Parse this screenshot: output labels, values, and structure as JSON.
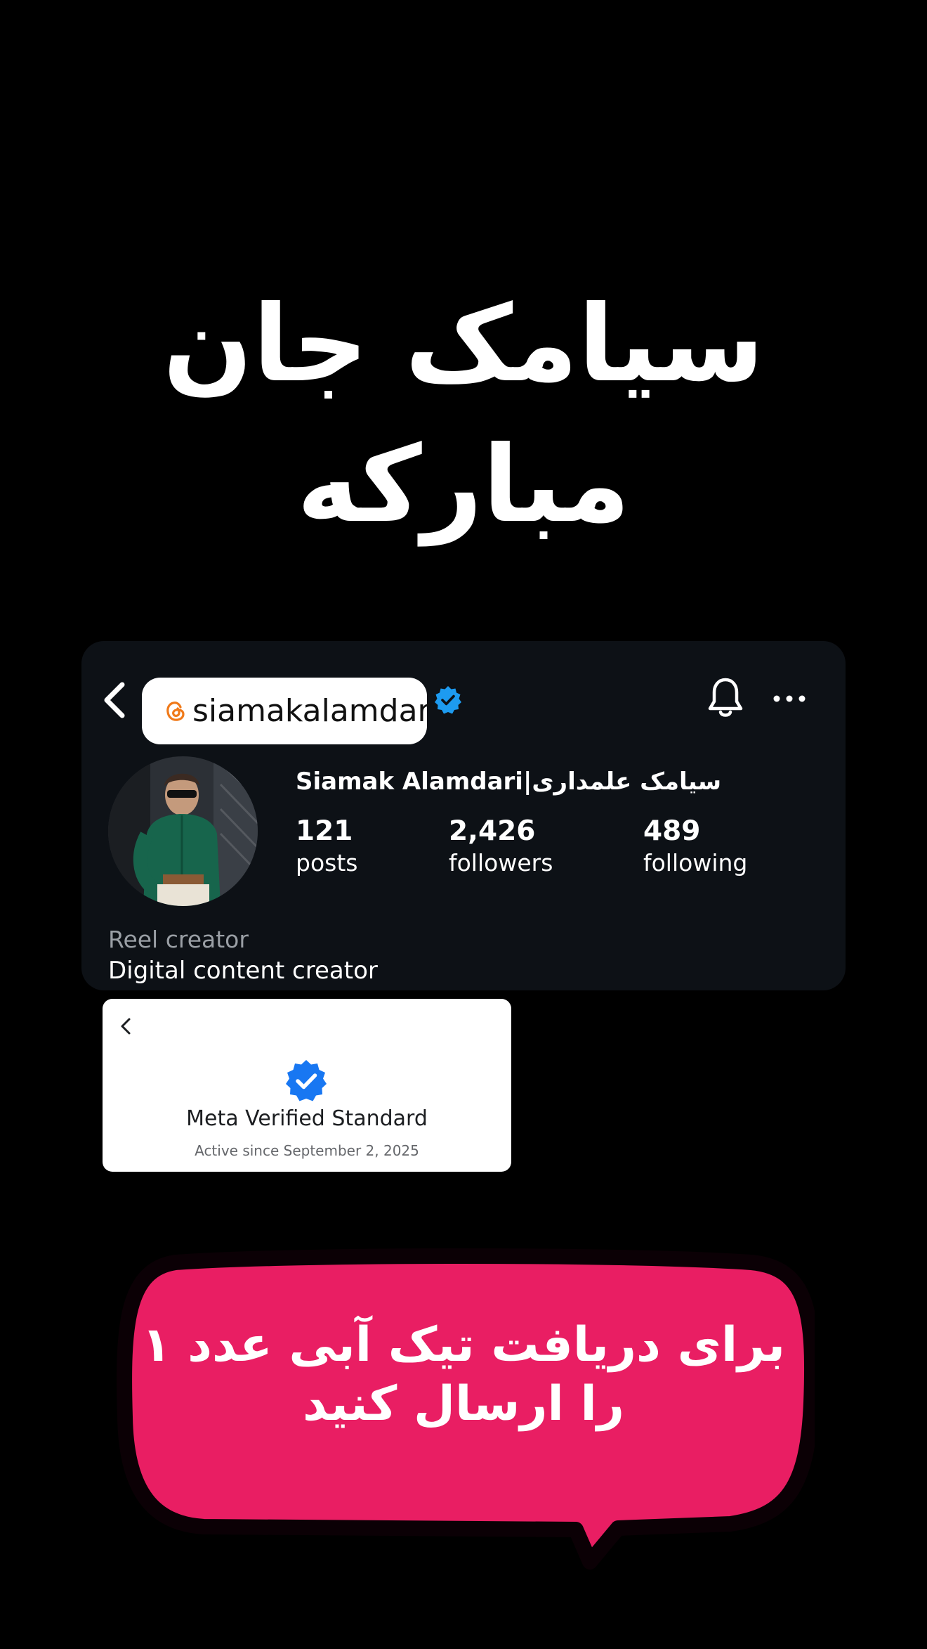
{
  "headline": "سیامک جان مبارکه",
  "profile": {
    "handle": "siamakalamdar",
    "display_name": "Siamak Alamdari|سیامک علمداری",
    "stats": {
      "posts_count": "121",
      "posts_label": "posts",
      "followers_count": "2,426",
      "followers_label": "followers",
      "following_count": "489",
      "following_label": "following"
    },
    "category": "Reel creator",
    "bio": "Digital content creator",
    "verified_color": "#1d9bf0"
  },
  "meta_verified": {
    "title": "Meta Verified Standard",
    "subtitle": "Active since September 2, 2025"
  },
  "cta": {
    "text": "برای دریافت تیک آبی عدد ۱ را ارسال کنید",
    "bubble_color": "#e91e63"
  },
  "icons": [
    "back-chevron-icon",
    "threads-icon",
    "verified-badge-icon",
    "bell-icon",
    "more-options-icon"
  ]
}
